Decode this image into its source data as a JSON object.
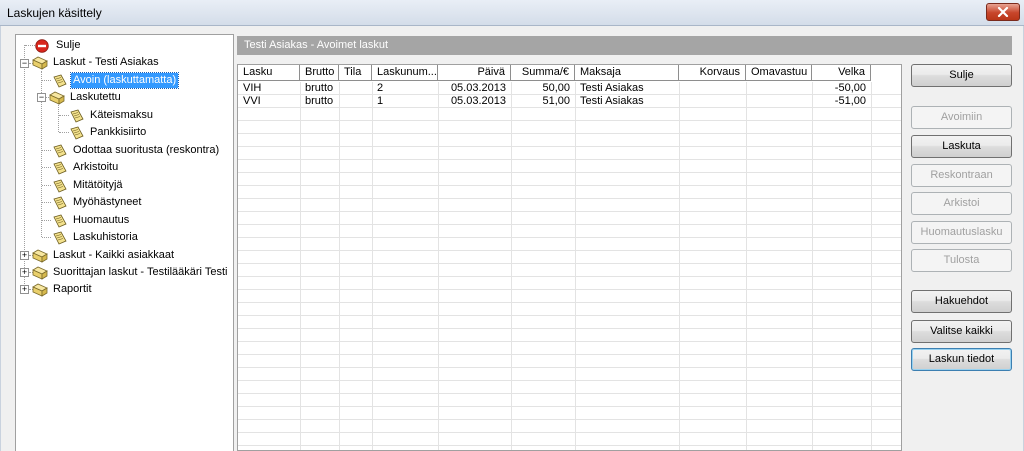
{
  "window": {
    "title": "Laskujen käsittely"
  },
  "tree": {
    "items": [
      {
        "label": "Sulje"
      },
      {
        "label": "Laskut - Testi Asiakas"
      },
      {
        "label": "Avoin (laskuttamatta)"
      },
      {
        "label": "Laskutettu"
      },
      {
        "label": "Käteismaksu"
      },
      {
        "label": "Pankkisiirto"
      },
      {
        "label": "Odottaa suoritusta (reskontra)"
      },
      {
        "label": "Arkistoitu"
      },
      {
        "label": "Mitätöityjä"
      },
      {
        "label": "Myöhästyneet"
      },
      {
        "label": "Huomautus"
      },
      {
        "label": "Laskuhistoria"
      },
      {
        "label": "Laskut - Kaikki asiakkaat"
      },
      {
        "label": "Suorittajan laskut - Testilääkäri Testi"
      },
      {
        "label": "Raportit"
      }
    ],
    "expand_plus": "+",
    "expand_minus": "−"
  },
  "panel": {
    "header": "Testi Asiakas - Avoimet laskut"
  },
  "table": {
    "columns": [
      "Lasku",
      "Brutto",
      "Tila",
      "Laskunum...",
      "Päivä",
      "Summa/€",
      "Maksaja",
      "Korvaus",
      "Omavastuu",
      "Velka"
    ],
    "rows": [
      [
        "VIH",
        "brutto",
        "",
        "2",
        "05.03.2013",
        "50,00",
        "Testi Asiakas",
        "",
        "",
        "-50,00"
      ],
      [
        "VVI",
        "brutto",
        "",
        "1",
        "05.03.2013",
        "51,00",
        "Testi Asiakas",
        "",
        "",
        "-51,00"
      ]
    ]
  },
  "buttons": {
    "sulje": "Sulje",
    "avoimiin": "Avoimiin",
    "laskuta": "Laskuta",
    "reskontraan": "Reskontraan",
    "arkistoi": "Arkistoi",
    "huomautuslasku": "Huomautuslasku",
    "tulosta": "Tulosta",
    "hakuehdot": "Hakuehdot",
    "valitse_kaikki": "Valitse kaikki",
    "laskun_tiedot": "Laskun tiedot"
  }
}
